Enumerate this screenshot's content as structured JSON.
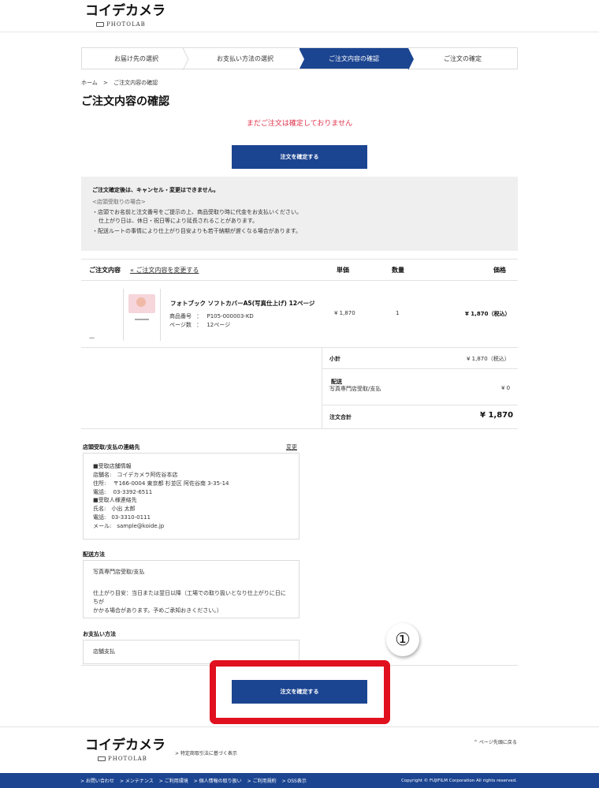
{
  "header": {
    "logo_main": "コイデカメラ",
    "logo_sub": "PHOTOLAB"
  },
  "steps": [
    {
      "label": "お届け先の選択"
    },
    {
      "label": "お支払い方法の選択"
    },
    {
      "label": "ご注文内容の確認",
      "active": true
    },
    {
      "label": "ご注文の確定"
    }
  ],
  "breadcrumb": {
    "home": "ホーム",
    "sep": ">",
    "current": "ご注文内容の確認"
  },
  "page_title": "ご注文内容の確認",
  "warning": "まだご注文は確定しておりません",
  "confirm_button": "注文を確定する",
  "notice": {
    "heading": "ご注文確定後は、キャンセル・変更はできません。",
    "group": "<店頭受取りの場合>",
    "item1_line1": "・店頭でお名前と注文番号をご提示の上、商品受取り時に代金をお支払いください。",
    "item1_line2": "仕上がり日は、休日・祝日等により延長されることがあります。",
    "item2": "・配送ルートの事情により仕上がり目安よりも若干納期が遅くなる場合があります。"
  },
  "order_table": {
    "col_content": "ご注文内容",
    "change_link": "« ご注文内容を変更する",
    "col_unit_price": "単価",
    "col_qty": "数量",
    "col_price": "価格",
    "item": {
      "name": "フォトブック ソフトカバーA5(写真仕上げ) 12ページ",
      "code_label": "商品番号",
      "code_sep": "：",
      "code": "P105-000003-KD",
      "pages_label": "ページ数",
      "pages_sep": "：",
      "pages": "12ページ",
      "unit_price": "¥ 1,870",
      "qty": "1",
      "price": "¥ 1,870（税込）"
    },
    "thumb_dash": "—"
  },
  "summary": {
    "subtotal_label": "小計",
    "subtotal": "¥ 1,870（税込）",
    "shipping_label": "配送",
    "shipping_method": "写真専門店受取/支払",
    "shipping": "¥ 0",
    "total_label": "注文合計",
    "total": "¥ 1,870"
  },
  "pickup": {
    "title": "店頭受取/支払の連絡先",
    "change": "変更",
    "lines": [
      "■受取店舗情報",
      "店舗名:　コイデカメラ阿佐谷本店",
      "住所:　 〒166-0004 東京都 杉並区 阿佐谷南 3-35-14",
      "電話:　 03-3392-6511",
      "■受取人様連絡先",
      "氏名:　小出 太郎",
      "電話:　03-3310-0111",
      "メール:　sample@koide.jp"
    ]
  },
  "delivery": {
    "title": "配送方法",
    "method": "写真専門店受取/支払",
    "note_line1": "仕上がり目安：当日または翌日以降（工場での取り扱いとなり仕上がりに日にちが",
    "note_line2": "かかる場合があります。予めご承知おきください。）"
  },
  "payment": {
    "title": "お支払い方法",
    "method": "店舗支払"
  },
  "annotation": {
    "circle": "①",
    "frame_color": "#e0101e"
  },
  "footer": {
    "logo_main": "コイデカメラ",
    "logo_sub": "PHOTOLAB",
    "law_link": "> 特定商取引法に基づく表示",
    "back_top": "^ ページ先頭に戻る",
    "links": [
      "> お問い合わせ",
      "> メンテナンス",
      "> ご利用環境",
      "> 個人情報の取り扱い",
      "> ご利用規約",
      "> OSS表示"
    ],
    "copyright": "Copyright © FUJIFILM Corporation All rights reserved."
  },
  "colors": {
    "accent": "#1c4591",
    "warning": "#e0344c"
  }
}
